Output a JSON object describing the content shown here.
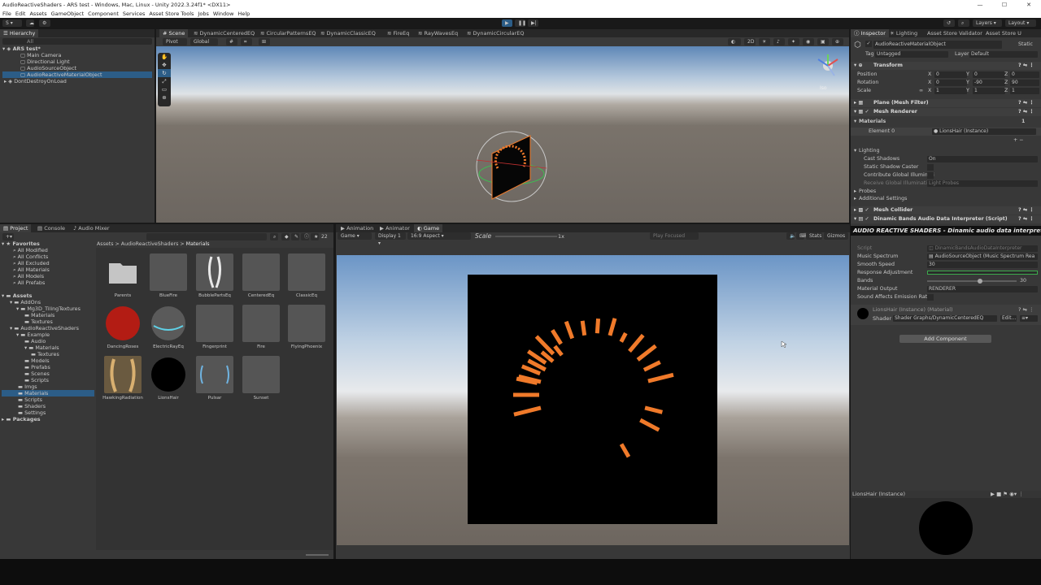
{
  "window": {
    "title": "AudioReactiveShaders - ARS test - Windows, Mac, Linux - Unity 2022.3.24f1* <DX11>",
    "minimize": "—",
    "maximize": "☐",
    "close": "✕"
  },
  "menu": [
    "File",
    "Edit",
    "Assets",
    "GameObject",
    "Component",
    "Services",
    "Asset Store Tools",
    "Jobs",
    "Window",
    "Help"
  ],
  "toolbar": {
    "account": "S",
    "layers": "Layers",
    "layout": "Layout"
  },
  "hierarchy": {
    "tab": "Hierarchy",
    "search_placeholder": "All",
    "scene": "ARS test*",
    "items": [
      "Main Camera",
      "Directional Light",
      "AudioSourceObject",
      "AudioReactiveMaterialObject"
    ],
    "dontdestroy": "DontDestroyOnLoad"
  },
  "scene_tabs": [
    "Scene",
    "DynamicCenteredEQ",
    "CircularPatternsEQ",
    "DynamicClassicEQ",
    "FireEq",
    "RayWavesEq",
    "DynamicCircularEQ"
  ],
  "scene_toolbar": {
    "pivot": "Pivot",
    "global": "Global",
    "mode2d": "2D",
    "persp": "Iso"
  },
  "project": {
    "tabs": [
      "Project",
      "Console",
      "Audio Mixer"
    ],
    "count": "22",
    "favorites_label": "Favorites",
    "favorites": [
      "All Modified",
      "All Conflicts",
      "All Excluded",
      "All Materials",
      "All Models",
      "All Prefabs"
    ],
    "assets_label": "Assets",
    "tree": [
      {
        "t": "AddOns",
        "d": 1
      },
      {
        "t": "Mg3D_TilingTextures",
        "d": 2
      },
      {
        "t": "Materials",
        "d": 3
      },
      {
        "t": "Textures",
        "d": 3
      },
      {
        "t": "AudioReactiveShaders",
        "d": 1
      },
      {
        "t": "Example",
        "d": 2
      },
      {
        "t": "Audio",
        "d": 3
      },
      {
        "t": "Materials",
        "d": 3
      },
      {
        "t": "Textures",
        "d": 4
      },
      {
        "t": "Models",
        "d": 3
      },
      {
        "t": "Prefabs",
        "d": 3
      },
      {
        "t": "Scenes",
        "d": 3
      },
      {
        "t": "Scripts",
        "d": 3
      },
      {
        "t": "Imgs",
        "d": 2
      },
      {
        "t": "Materials",
        "d": 2
      },
      {
        "t": "Scripts",
        "d": 2
      },
      {
        "t": "Shaders",
        "d": 2
      },
      {
        "t": "Settings",
        "d": 2
      }
    ],
    "packages_label": "Packages",
    "breadcrumb": [
      "Assets",
      "AudioReactiveShaders",
      "Materials"
    ],
    "thumbs": [
      "Parents",
      "BlueFire",
      "BubblePartsEq",
      "CenteredEq",
      "ClassicEq",
      "DancingRoses",
      "ElectricRayEq",
      "Fingerprint",
      "Fire",
      "FlyingPhoenix",
      "HawkingRadiation",
      "LionsHair",
      "Pulsar",
      "Sunset"
    ]
  },
  "game": {
    "tabs": [
      "Animation",
      "Animator",
      "Game"
    ],
    "display_mode": "Game",
    "display": "Display 1",
    "aspect": "16:9 Aspect",
    "scale_label": "Scale",
    "scale_value": "1x",
    "play_focused": "Play Focused",
    "stats": "Stats",
    "gizmos": "Gizmos",
    "eq_color": "#f07a2a"
  },
  "inspector": {
    "tabs": [
      "Inspector",
      "Lighting",
      "Asset Store Validator",
      "Asset Store U"
    ],
    "object_name": "AudioReactiveMaterialObject",
    "static": "Static",
    "tag_label": "Tag",
    "tag": "Untagged",
    "layer_label": "Layer",
    "layer": "Default",
    "transform": "Transform",
    "position_label": "Position",
    "rotation_label": "Rotation",
    "scale_label": "Scale",
    "pos": [
      "0",
      "0",
      "0"
    ],
    "rot": [
      "0",
      "-90",
      "90"
    ],
    "scale": [
      "1",
      "1",
      "1"
    ],
    "mesh_filter": "Plane (Mesh Filter)",
    "mesh_renderer": "Mesh Renderer",
    "materials_label": "Materials",
    "materials_count": "1",
    "element0_label": "Element 0",
    "element0": "LionsHair (Instance)",
    "lighting_label": "Lighting",
    "cast_shadows_label": "Cast Shadows",
    "cast_shadows": "On",
    "static_shadow": "Static Shadow Caster",
    "contrib_gi": "Contribute Global Illuminati",
    "receive_gi": "Receive Global Illuminatio",
    "receive_gi_val": "Light Probes",
    "probes": "Probes",
    "additional": "Additional Settings",
    "mesh_collider": "Mesh Collider",
    "script_comp": "Dinamic Bands Audio Data Interpreter (Script)",
    "banner": "AUDIO REACTIVE SHADERS - Dinamic audio data interpreter",
    "script_label": "Script",
    "script_val": "DinamicBandsAudioDataInterpreter",
    "spectrum_label": "Music Spectrum",
    "spectrum_val": "AudioSourceObject (Music Spectrum Rea",
    "smooth_label": "Smooth Speed",
    "smooth_val": "30",
    "response_label": "Response Adjustment",
    "bands_label": "Bands",
    "bands_val": "30",
    "bands_fraction": 0.6,
    "output_label": "Material Output",
    "output_val": "RENDERER",
    "emission_label": "Sound Affects Emission Rate",
    "material_name": "LionsHair (Instance) (Material)",
    "shader_label": "Shader",
    "shader_val": "Shader Graphs/DynamicCenteredEQ",
    "edit": "Edit...",
    "add_component": "Add Component",
    "preview_title": "LionsHair (Instance)"
  }
}
